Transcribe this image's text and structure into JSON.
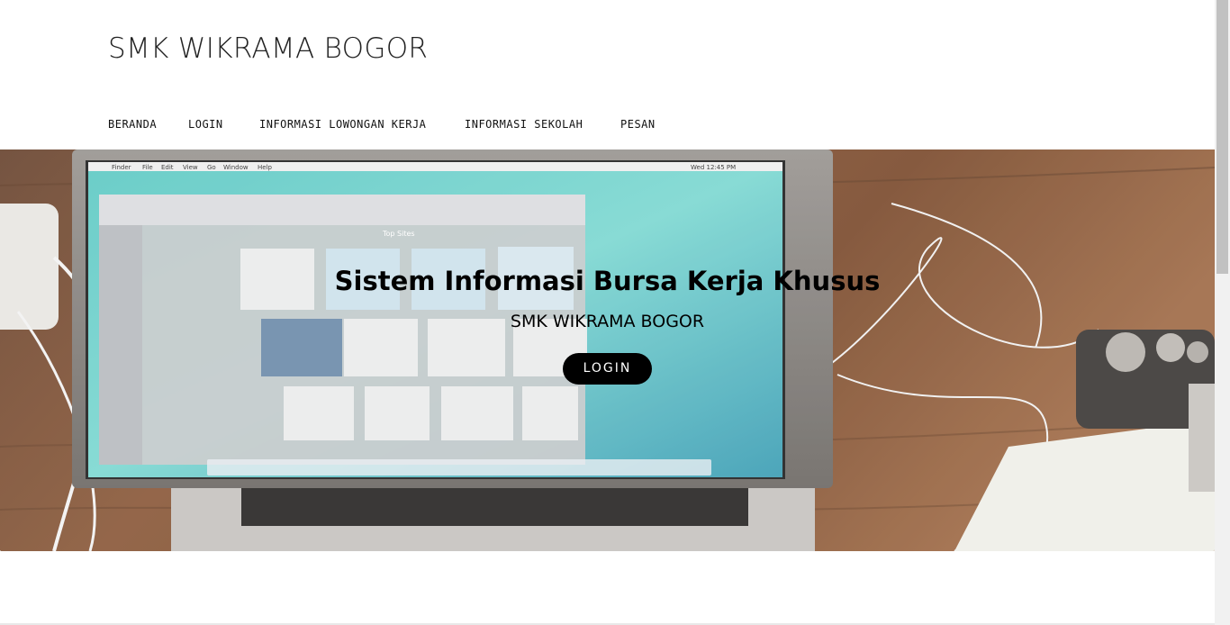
{
  "header": {
    "site_title": "SMK WIKRAMA BOGOR"
  },
  "nav": {
    "items": [
      {
        "label": "BERANDA"
      },
      {
        "label": "LOGIN"
      },
      {
        "label": "INFORMASI LOWONGAN KERJA"
      },
      {
        "label": "INFORMASI SEKOLAH"
      },
      {
        "label": "PESAN"
      }
    ]
  },
  "hero": {
    "title": "Sistem Informasi Bursa Kerja Khusus",
    "subtitle": "SMK WIKRAMA BOGOR",
    "button_label": "LOGIN",
    "laptop_menu": [
      "Finder",
      "File",
      "Edit",
      "View",
      "Go",
      "Window",
      "Help"
    ],
    "laptop_clock": "Wed 12:45 PM",
    "browser_heading": "Top Sites"
  },
  "colors": {
    "button_bg": "#000000",
    "button_text": "#ffffff",
    "wood": "#7a4e30"
  }
}
